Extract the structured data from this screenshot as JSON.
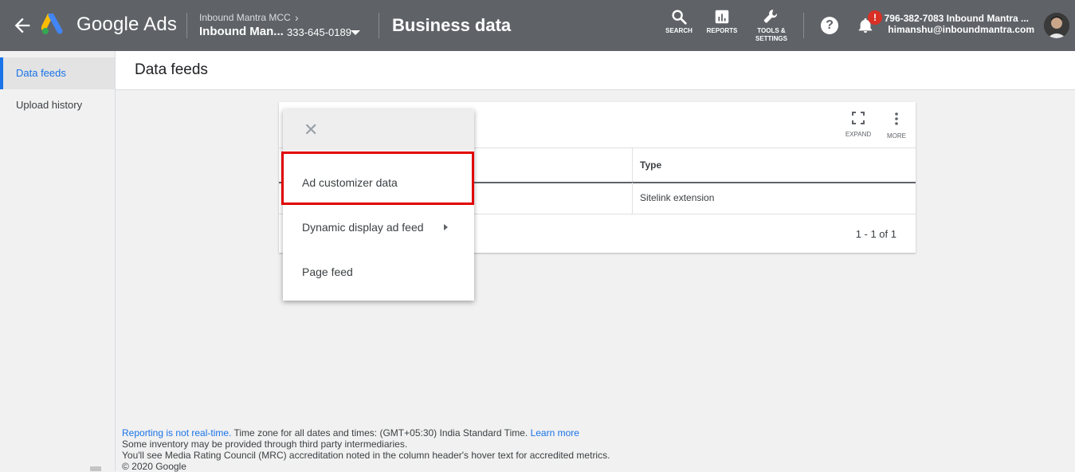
{
  "topbar": {
    "brand": "Google Ads",
    "account_parent": "Inbound Mantra MCC",
    "account_name": "Inbound Man...",
    "account_id": "333-645-0189",
    "page_heading": "Business data",
    "tools": [
      {
        "label": "SEARCH",
        "icon": "search-icon"
      },
      {
        "label": "REPORTS",
        "icon": "reports-icon"
      },
      {
        "label": "TOOLS &",
        "label2": "SETTINGS",
        "icon": "wrench-icon"
      }
    ],
    "help_glyph": "?",
    "notification_badge": "!",
    "user_line1": "796-382-7083 Inbound Mantra ...",
    "user_line2": "himanshu@inboundmantra.com"
  },
  "sidebar": {
    "items": [
      {
        "label": "Data feeds",
        "active": true
      },
      {
        "label": "Upload history",
        "active": false
      }
    ]
  },
  "main": {
    "title": "Data feeds",
    "card": {
      "expand_label": "EXPAND",
      "more_label": "MORE",
      "columns": [
        "Type"
      ],
      "rows": [
        {
          "type": "Sitelink extension"
        }
      ],
      "pagination": "1 - 1 of 1"
    },
    "menu": {
      "close_glyph": "✕",
      "items": [
        {
          "label": "Ad customizer data",
          "highlighted": true
        },
        {
          "label": "Dynamic display ad feed",
          "has_submenu": true
        },
        {
          "label": "Page feed"
        }
      ]
    }
  },
  "footer": {
    "link1": "Reporting is not real-time.",
    "text1": " Time zone for all dates and times: (GMT+05:30) India Standard Time. ",
    "link2": "Learn more",
    "line2": "Some inventory may be provided through third party intermediaries.",
    "line3": "You'll see Media Rating Council (MRC) accreditation noted in the column header's hover text for accredited metrics.",
    "line4": "© 2020 Google"
  },
  "colors": {
    "topbar": "#5f6368",
    "accent": "#1a73e8",
    "highlight_border": "#e00000",
    "badge": "#d93025"
  }
}
